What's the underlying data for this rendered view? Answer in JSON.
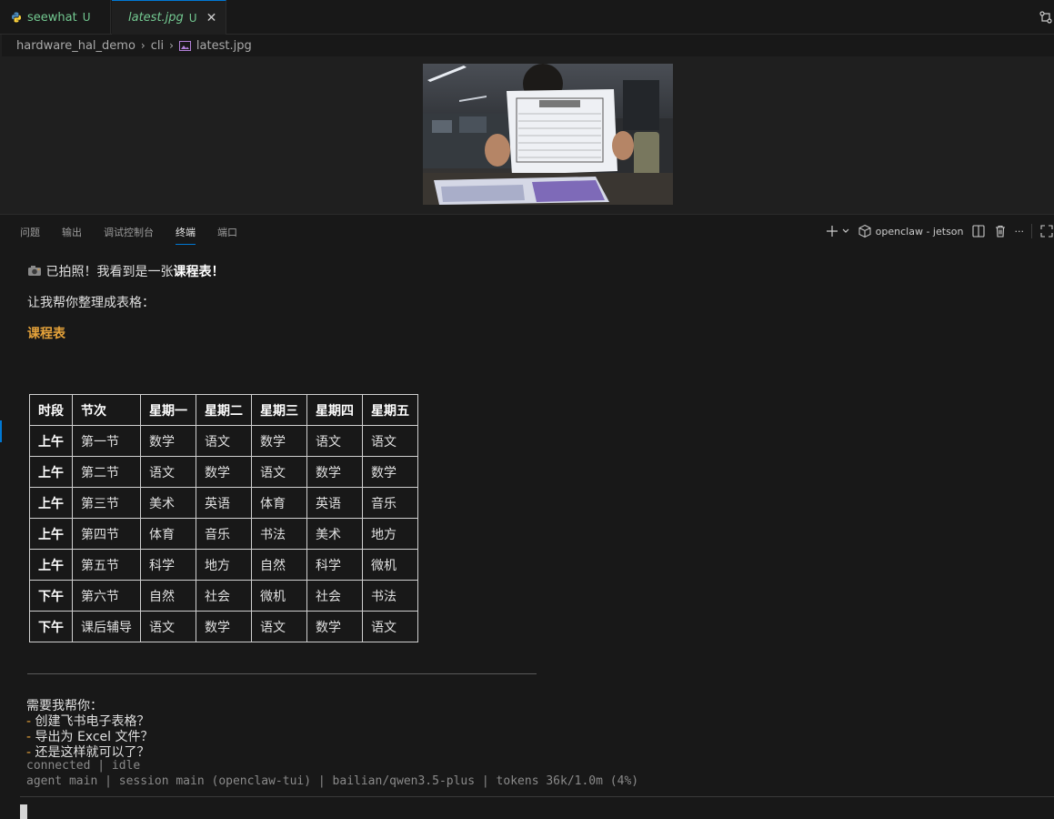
{
  "tabs": [
    {
      "label": "seewhat",
      "badge": "U",
      "icon": "python-icon"
    },
    {
      "label": "latest.jpg",
      "badge": "U",
      "icon": "image-icon",
      "close": "✕"
    }
  ],
  "breadcrumb": {
    "items": [
      "hardware_hal_demo",
      "cli",
      "latest.jpg"
    ],
    "separator": "›"
  },
  "panel": {
    "tabs": [
      "问题",
      "输出",
      "调试控制台",
      "终端",
      "端口"
    ],
    "active_tab": "终端",
    "terminal_name": "openclaw - jetson",
    "more": "···"
  },
  "message": {
    "line1_prefix": "已拍照！我看到是一张",
    "line1_bold": "课程表",
    "line1_suffix": "！",
    "line2": "让我帮你整理成表格：",
    "table_title": "课程表"
  },
  "schedule": {
    "headers": [
      "时段",
      "节次",
      "星期一",
      "星期二",
      "星期三",
      "星期四",
      "星期五"
    ],
    "rows": [
      [
        "上午",
        "第一节",
        "数学",
        "语文",
        "数学",
        "语文",
        "语文"
      ],
      [
        "上午",
        "第二节",
        "语文",
        "数学",
        "语文",
        "数学",
        "数学"
      ],
      [
        "上午",
        "第三节",
        "美术",
        "英语",
        "体育",
        "英语",
        "音乐"
      ],
      [
        "上午",
        "第四节",
        "体育",
        "音乐",
        "书法",
        "美术",
        "地方"
      ],
      [
        "上午",
        "第五节",
        "科学",
        "地方",
        "自然",
        "科学",
        "微机"
      ],
      [
        "下午",
        "第六节",
        "自然",
        "社会",
        "微机",
        "社会",
        "书法"
      ],
      [
        "下午",
        "课后辅导",
        "语文",
        "数学",
        "语文",
        "数学",
        "语文"
      ]
    ]
  },
  "followup": {
    "intro": "需要我帮你：",
    "bullet": "-",
    "options": [
      "创建飞书电子表格？",
      "导出为 Excel 文件？",
      "还是这样就可以了？"
    ]
  },
  "status": {
    "connection": "connected | idle",
    "session": "agent main | session main (openclaw-tui) | bailian/qwen3.5-plus | tokens 36k/1.0m (4%)"
  },
  "colors": {
    "accent": "#0078d4",
    "untracked": "#73c991",
    "heading": "#e5a23a",
    "background": "#181818"
  }
}
